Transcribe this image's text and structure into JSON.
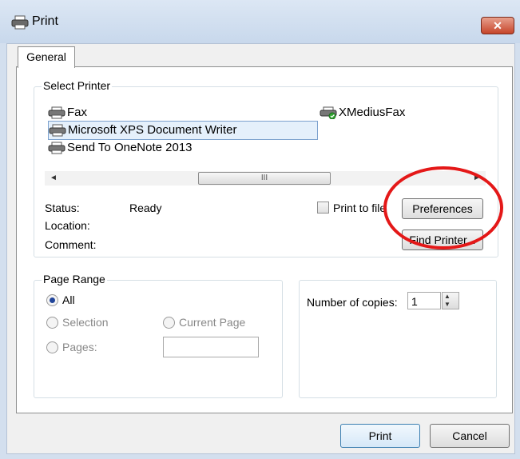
{
  "window": {
    "title": "Print",
    "close_glyph": "✕"
  },
  "tabs": [
    {
      "label": "General",
      "active": true
    }
  ],
  "select_printer": {
    "legend": "Select Printer",
    "printers": [
      {
        "name": "Fax",
        "icon": "printer-icon",
        "selected": false
      },
      {
        "name": "Microsoft XPS Document Writer",
        "icon": "printer-icon",
        "selected": true
      },
      {
        "name": "Send To OneNote 2013",
        "icon": "printer-icon",
        "selected": false
      },
      {
        "name": "XMediusFax",
        "icon": "printer-check-icon",
        "selected": false
      }
    ],
    "scrollbar": {
      "left_glyph": "◄",
      "thumb_glyph": "III",
      "right_glyph": "►"
    },
    "status_label": "Status:",
    "status_value": "Ready",
    "location_label": "Location:",
    "comment_label": "Comment:",
    "print_to_file_label": "Print to file",
    "preferences_label": "Preferences",
    "find_printer_label": "Find Printer..."
  },
  "page_range": {
    "legend": "Page Range",
    "all_label": "All",
    "selection_label": "Selection",
    "current_page_label": "Current Page",
    "pages_label": "Pages:",
    "pages_value": ""
  },
  "copies": {
    "label": "Number of copies:",
    "value": "1"
  },
  "buttons": {
    "print": "Print",
    "cancel": "Cancel"
  },
  "annotation_color": "#e41818"
}
